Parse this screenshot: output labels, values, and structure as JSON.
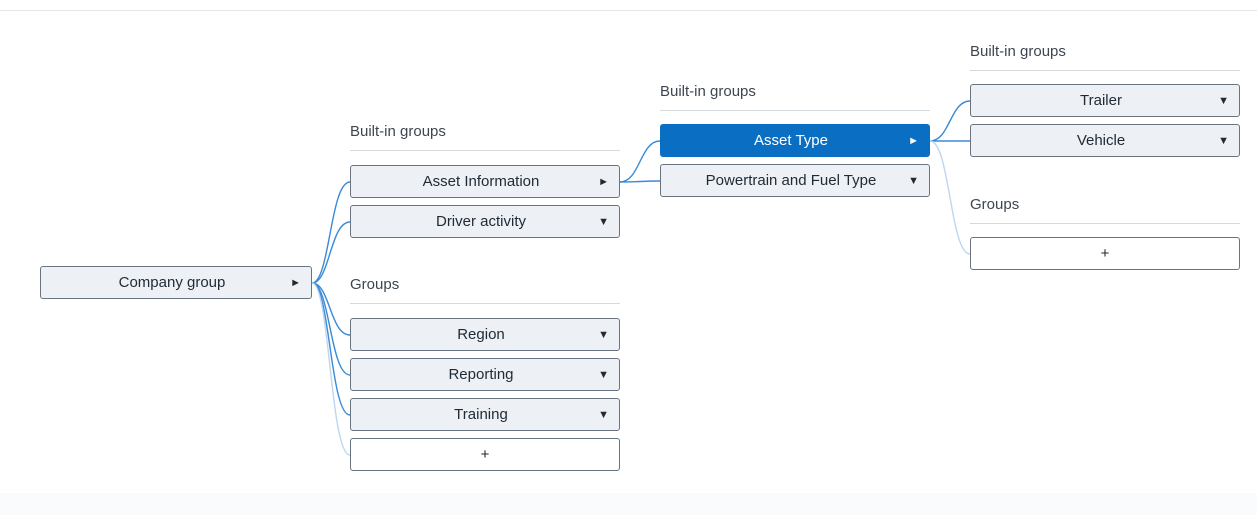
{
  "root": {
    "label": "Company group",
    "caret": "►"
  },
  "level1": {
    "builtin_heading": "Built-in groups",
    "builtin_items": [
      {
        "label": "Asset Information",
        "caret": "►"
      },
      {
        "label": "Driver activity",
        "caret": "▼"
      }
    ],
    "groups_heading": "Groups",
    "group_items": [
      {
        "label": "Region",
        "caret": "▼"
      },
      {
        "label": "Reporting",
        "caret": "▼"
      },
      {
        "label": "Training",
        "caret": "▼"
      }
    ],
    "add_label": "+"
  },
  "level2": {
    "builtin_heading": "Built-in groups",
    "builtin_items": [
      {
        "label": "Asset Type",
        "caret": "►",
        "selected": true
      },
      {
        "label": "Powertrain and Fuel Type",
        "caret": "▼"
      }
    ]
  },
  "level3": {
    "builtin_heading": "Built-in groups",
    "builtin_items": [
      {
        "label": "Trailer",
        "caret": "▼"
      },
      {
        "label": "Vehicle",
        "caret": "▼"
      }
    ],
    "groups_heading": "Groups",
    "add_label": "+"
  },
  "colors": {
    "accent": "#0a6fc2",
    "connector": "#3a8ad6",
    "connector_faint": "#bcd6ef",
    "node_bg": "#edf0f4",
    "node_border": "#697480"
  }
}
